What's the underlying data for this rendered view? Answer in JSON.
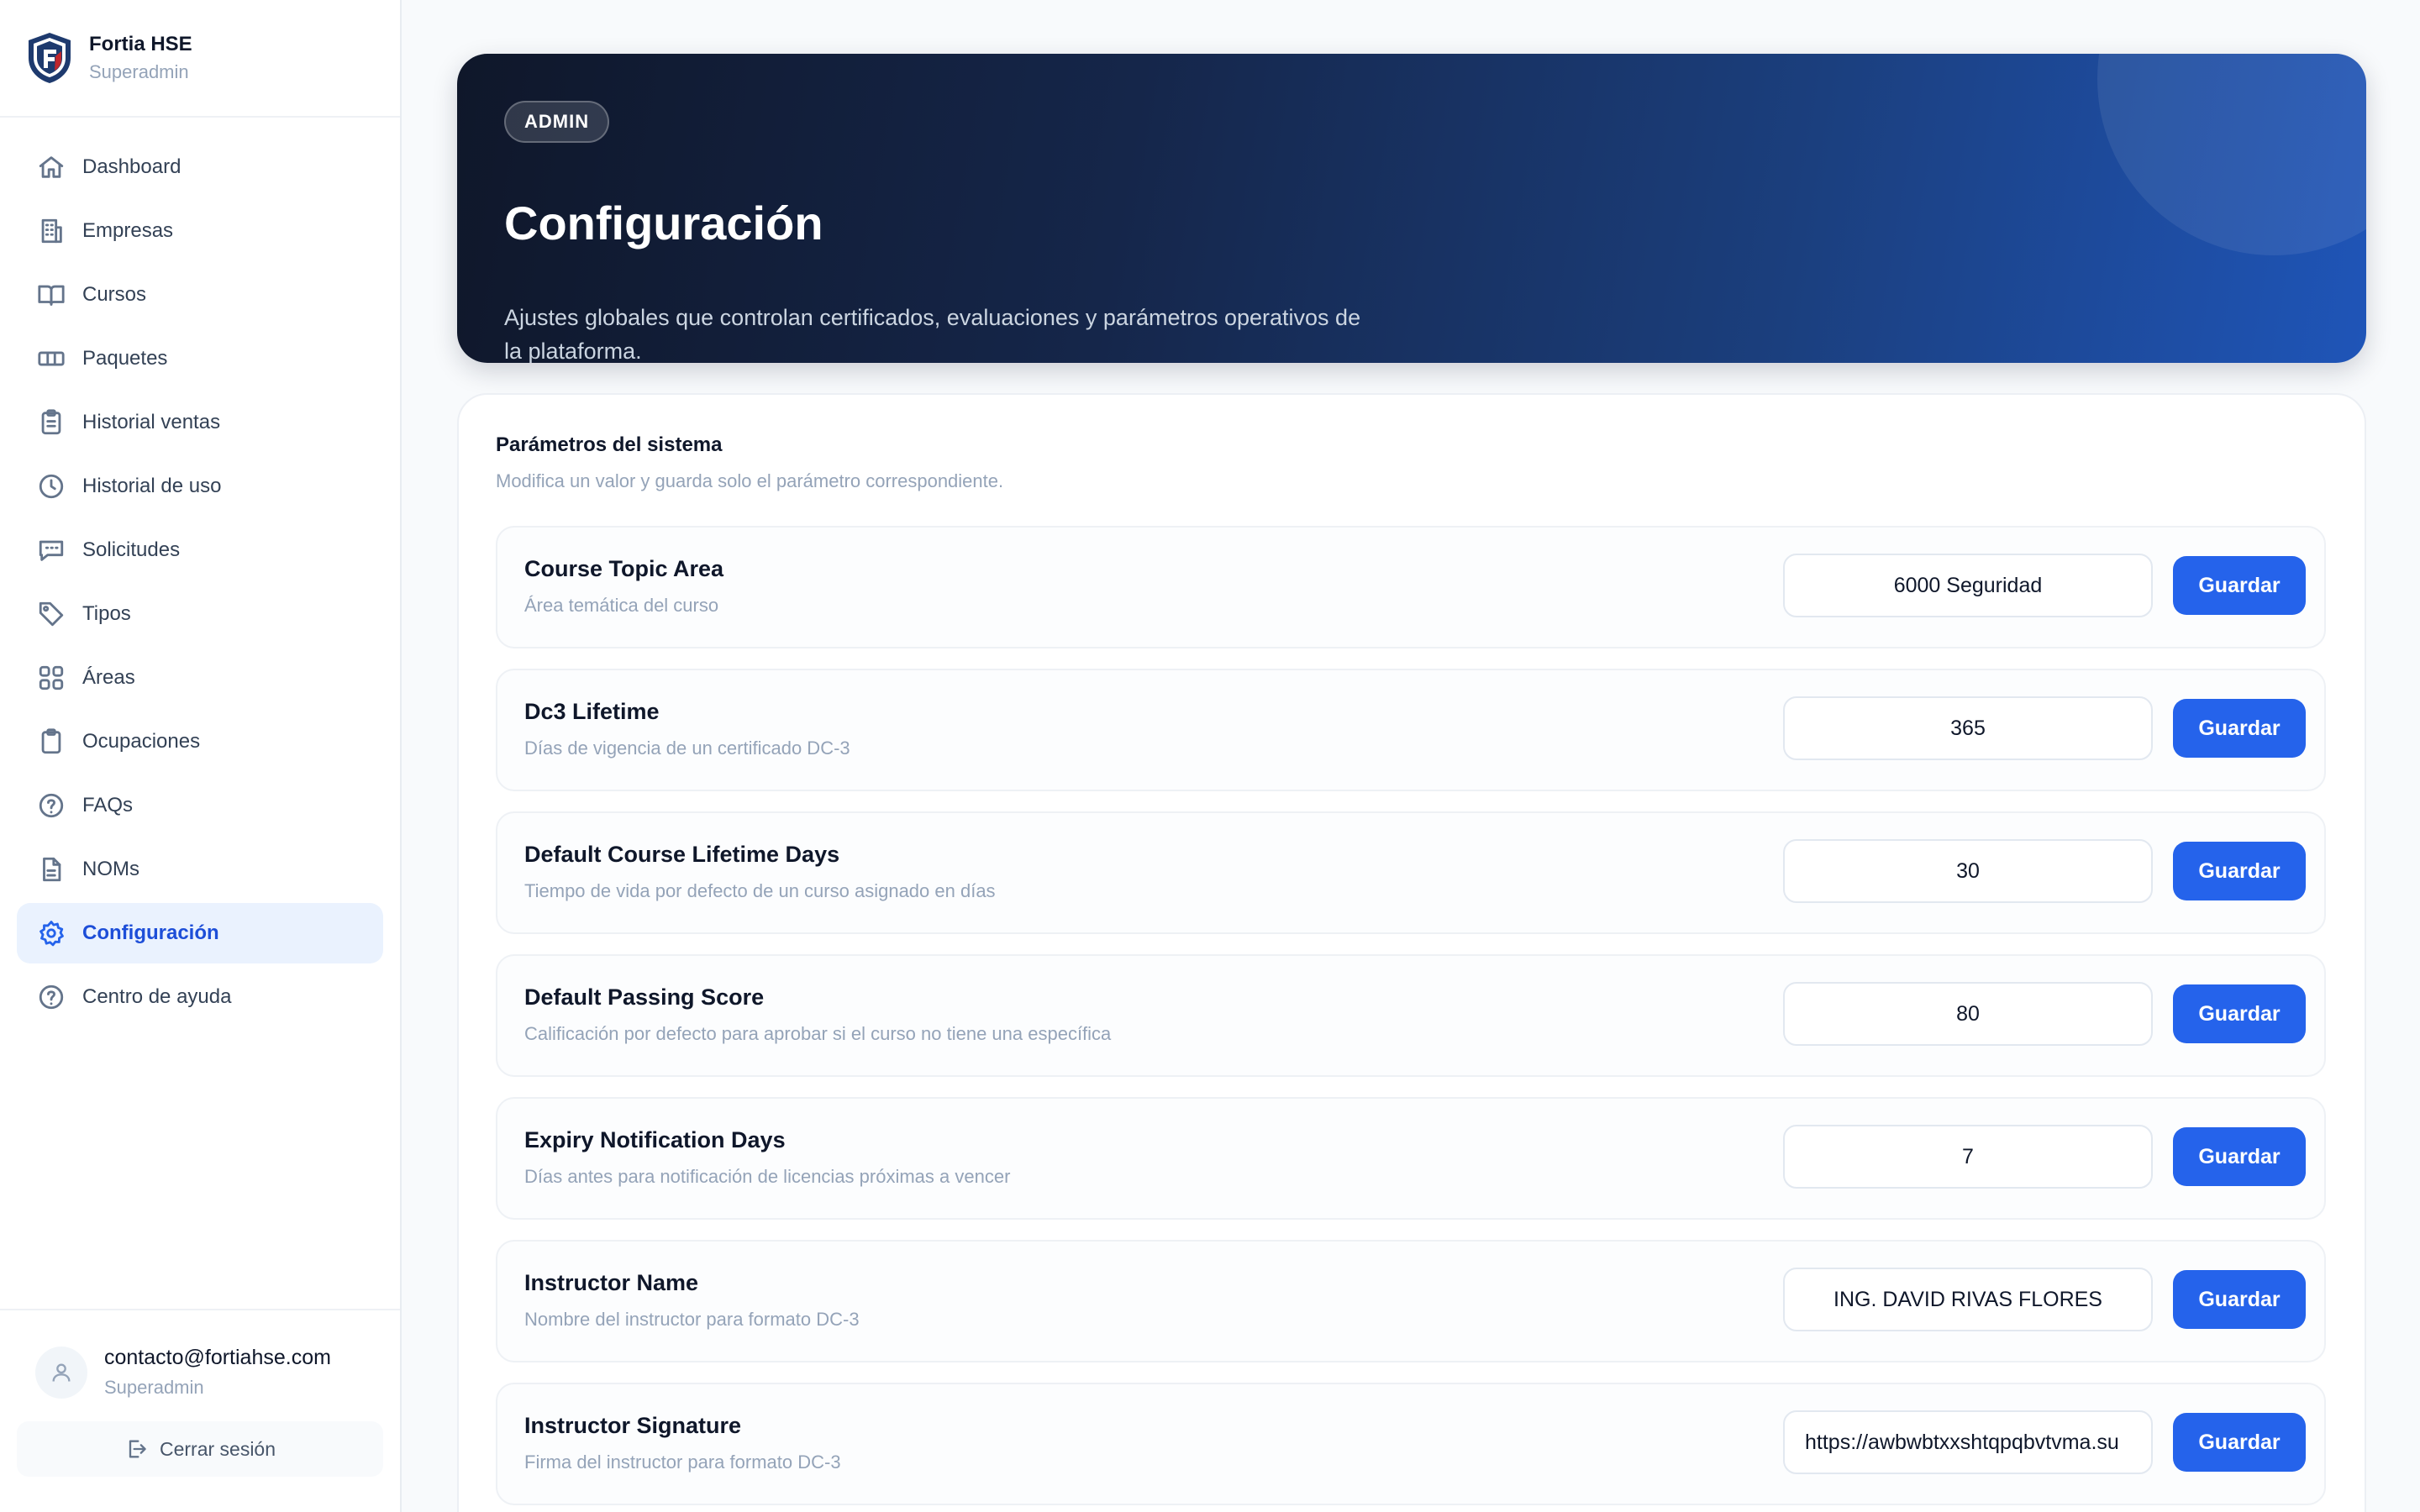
{
  "brand": {
    "name": "Fortia HSE",
    "role": "Superadmin",
    "logo_icon": "shield-logo-icon"
  },
  "sidebar": {
    "items": [
      {
        "label": "Dashboard",
        "icon": "home-icon"
      },
      {
        "label": "Empresas",
        "icon": "building-icon"
      },
      {
        "label": "Cursos",
        "icon": "book-icon"
      },
      {
        "label": "Paquetes",
        "icon": "ticket-icon"
      },
      {
        "label": "Historial ventas",
        "icon": "clipboard-icon"
      },
      {
        "label": "Historial de uso",
        "icon": "clock-icon"
      },
      {
        "label": "Solicitudes",
        "icon": "message-icon"
      },
      {
        "label": "Tipos",
        "icon": "tag-icon"
      },
      {
        "label": "Áreas",
        "icon": "grid-icon"
      },
      {
        "label": "Ocupaciones",
        "icon": "clipboard-icon"
      },
      {
        "label": "FAQs",
        "icon": "help-circle-icon"
      },
      {
        "label": "NOMs",
        "icon": "file-icon"
      },
      {
        "label": "Configuración",
        "icon": "gear-icon",
        "active": true
      },
      {
        "label": "Centro de ayuda",
        "icon": "help-circle-icon"
      }
    ]
  },
  "user": {
    "email": "contacto@fortiahse.com",
    "role": "Superadmin",
    "logout_label": "Cerrar sesión"
  },
  "hero": {
    "badge": "ADMIN",
    "title": "Configuración",
    "description": "Ajustes globales que controlan certificados, evaluaciones y parámetros operativos de la plataforma."
  },
  "params_card": {
    "title": "Parámetros del sistema",
    "subtitle": "Modifica un valor y guarda solo el parámetro correspondiente.",
    "save_label": "Guardar",
    "items": [
      {
        "name": "Course Topic Area",
        "description": "Área temática del curso",
        "value": "6000 Seguridad"
      },
      {
        "name": "Dc3 Lifetime",
        "description": "Días de vigencia de un certificado DC-3",
        "value": "365"
      },
      {
        "name": "Default Course Lifetime Days",
        "description": "Tiempo de vida por defecto de un curso asignado en días",
        "value": "30"
      },
      {
        "name": "Default Passing Score",
        "description": "Calificación por defecto para aprobar si el curso no tiene una específica",
        "value": "80"
      },
      {
        "name": "Expiry Notification Days",
        "description": "Días antes para notificación de licencias próximas a vencer",
        "value": "7"
      },
      {
        "name": "Instructor Name",
        "description": "Nombre del instructor para formato DC-3",
        "value": "ING. DAVID RIVAS FLORES"
      },
      {
        "name": "Instructor Signature",
        "description": "Firma del instructor para formato DC-3",
        "value": "https://awbwbtxxshtqpqbvtvma.su"
      }
    ]
  },
  "colors": {
    "accent": "#2563eb",
    "active_bg": "#eaf2fe",
    "hero_dark": "#0f172a",
    "hero_blue": "#1f55b8"
  }
}
